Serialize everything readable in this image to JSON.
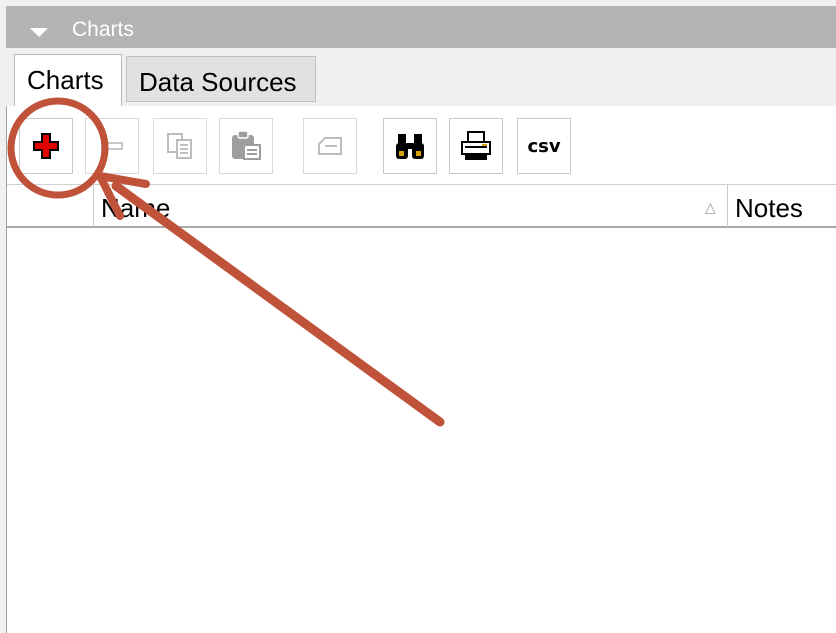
{
  "panel": {
    "title": "Charts"
  },
  "tabs": [
    {
      "label": "Charts",
      "active": true
    },
    {
      "label": "Data Sources",
      "active": false
    }
  ],
  "toolbar": {
    "buttons": [
      {
        "icon": "add-icon",
        "enabled": true
      },
      {
        "icon": "remove-icon",
        "enabled": false
      },
      {
        "icon": "copy-icon",
        "enabled": false
      },
      {
        "icon": "paste-icon",
        "enabled": false
      },
      {
        "icon": "edit-icon",
        "enabled": false
      },
      {
        "icon": "binoculars-icon",
        "enabled": true
      },
      {
        "icon": "print-icon",
        "enabled": true
      },
      {
        "icon": "csv-icon",
        "label": "csv",
        "enabled": true
      }
    ]
  },
  "grid": {
    "columns": [
      {
        "label": "Name",
        "sort": "ascending"
      },
      {
        "label": "Notes"
      }
    ],
    "rows": []
  },
  "annotation": {
    "color": "#c0523a",
    "shapes": [
      "circle",
      "arrow"
    ]
  }
}
